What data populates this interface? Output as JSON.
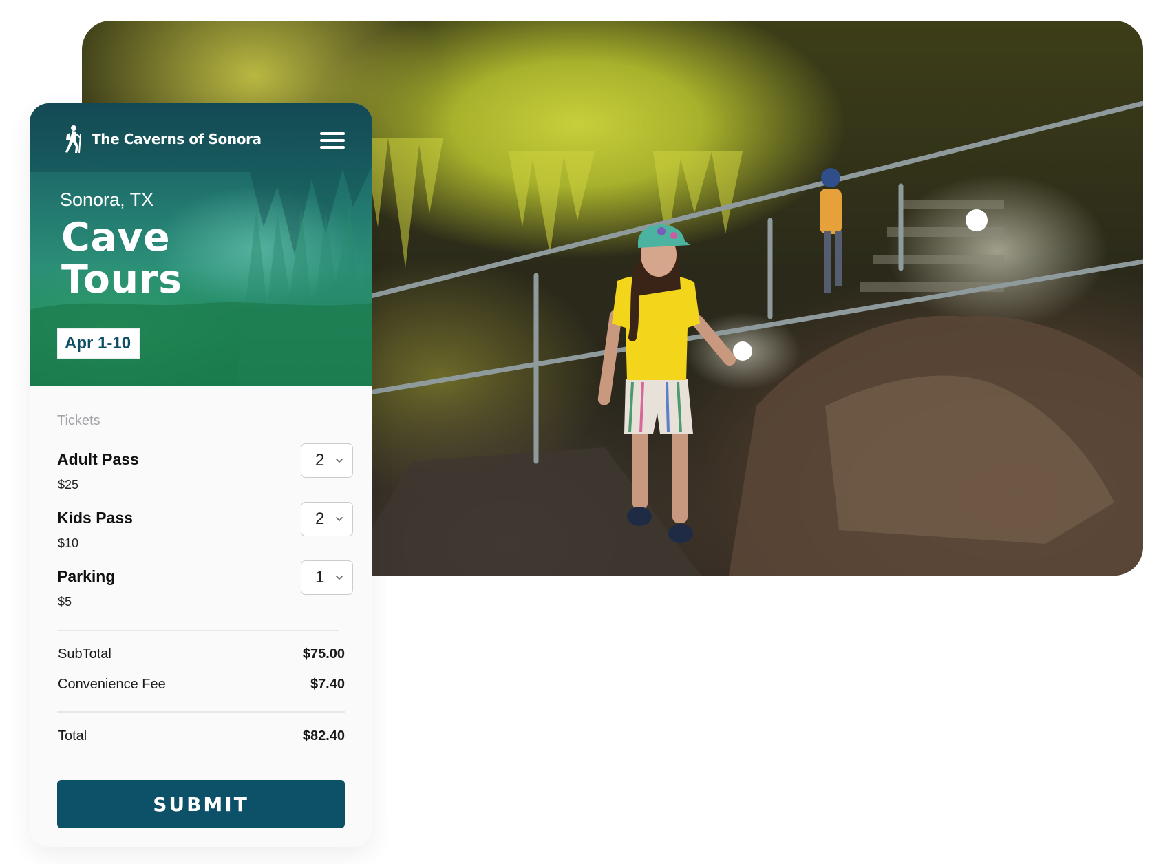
{
  "header": {
    "brand_name": "The Caverns of Sonora",
    "location": "Sonora, TX",
    "title_line1": "Cave",
    "title_line2": "Tours",
    "date_badge": "Apr 1-10"
  },
  "tickets": {
    "label": "Tickets",
    "items": [
      {
        "name": "Adult Pass",
        "price": "$25",
        "quantity": "2"
      },
      {
        "name": "Kids Pass",
        "price": "$10",
        "quantity": "2"
      },
      {
        "name": "Parking",
        "price": "$5",
        "quantity": "1"
      }
    ]
  },
  "summary": {
    "subtotal_label": "SubTotal",
    "subtotal_value": "$75.00",
    "fee_label": "Convenience Fee",
    "fee_value": "$7.40",
    "total_label": "Total",
    "total_value": "$82.40"
  },
  "actions": {
    "submit_label": "SUBMIT"
  },
  "colors": {
    "accent": "#0d5168",
    "header_gradient_top": "#164f5c",
    "header_gradient_bottom": "#177a4d",
    "date_text": "#0f4f66"
  },
  "icons": {
    "brand": "hiker-icon",
    "menu": "hamburger-menu-icon",
    "select": "chevron-down-icon"
  }
}
